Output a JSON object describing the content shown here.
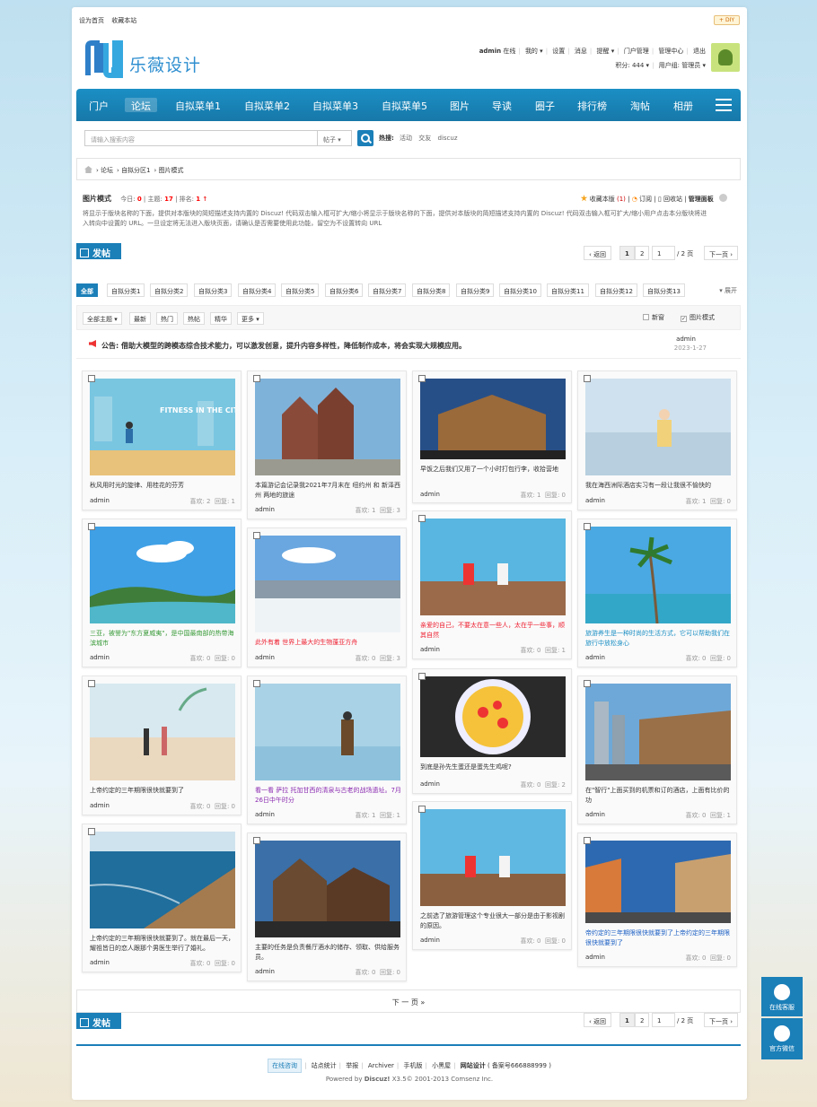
{
  "top": {
    "set_home": "设为首页",
    "bookmark": "收藏本站",
    "diy": "DIY"
  },
  "logo": {
    "text": "乐薇设计"
  },
  "user": {
    "name": "admin",
    "online": "在线",
    "mine": "我的",
    "settings": "设置",
    "messages": "消息",
    "remind": "提醒",
    "portal_manage": "门户管理",
    "admin_center": "管理中心",
    "logout": "退出",
    "points": "积分: 444",
    "group": "用户组: 管理员"
  },
  "nav": [
    "门户",
    "论坛",
    "自拟菜单1",
    "自拟菜单2",
    "自拟菜单3",
    "自拟菜单5",
    "图片",
    "导读",
    "圈子",
    "排行榜",
    "淘帖",
    "相册"
  ],
  "search": {
    "placeholder": "请输入搜索内容",
    "type": "帖子",
    "hot_label": "热搜:",
    "hot": [
      "活动",
      "交友",
      "discuz"
    ]
  },
  "breadcrumb": [
    "论坛",
    "自拟分区1",
    "图片模式"
  ],
  "forum": {
    "name": "图片模式",
    "today_label": "今日:",
    "today": "0",
    "threads_label": "主题:",
    "threads": "17",
    "rank_label": "排名:",
    "rank": "1",
    "fav": "收藏本版",
    "fav_count": "(1)",
    "subscribe": "订阅",
    "recycle": "回收站",
    "manage": "管理面板",
    "desc": "将显示于版块名称的下面，提供对本版块的简短描述支持内置的 Discuz! 代码双击输入框可扩大/缩小将显示于版块名称的下面，提供对本版块的简短描述支持内置的 Discuz! 代码双击输入框可扩大/缩小用户点击本分版块将进入转向中设置的 URL。一旦设定将无法进入版块页面，请确认是否需要使用此功能，留空为不设置转向 URL"
  },
  "post_btn": "发帖",
  "pager": {
    "back": "返回",
    "p1": "1",
    "p2": "2",
    "input": "1",
    "total": "/ 2 页",
    "next": "下一页"
  },
  "categories": [
    "全部",
    "自拟分类1",
    "自拟分类2",
    "自拟分类3",
    "自拟分类4",
    "自拟分类5",
    "自拟分类6",
    "自拟分类7",
    "自拟分类8",
    "自拟分类9",
    "自拟分类10",
    "自拟分类11",
    "自拟分类12",
    "自拟分类13"
  ],
  "expand": "展开",
  "filters": {
    "all": "全部主题",
    "latest": "最新",
    "hot": "热门",
    "hotpost": "热帖",
    "digest": "精华",
    "more": "更多",
    "newwin": "新窗",
    "picmode": "图片模式"
  },
  "notice": {
    "text": "公告: 借助大模型的跨模态综合技术能力，可以激发创意，提升内容多样性，降低制作成本，将会实现大规模应用。",
    "author": "admin",
    "date": "2023-1-27"
  },
  "cards": [
    {
      "title": "秋风用时光的旋律、用桂花的芬芳",
      "color": "#333",
      "author": "admin",
      "likes": "喜欢: 2",
      "replies": "回复: 1"
    },
    {
      "title": "本篇游记会记录我2021年7月末在 纽约州 和 新泽西州 两地的旅途",
      "color": "#333",
      "author": "admin",
      "likes": "喜欢: 1",
      "replies": "回复: 3"
    },
    {
      "title": "早饭之后我们又用了一个小时打包行李，收拾营地",
      "color": "#333",
      "author": "admin",
      "likes": "喜欢: 1",
      "replies": "回复: 0"
    },
    {
      "title": "我在海西洲际酒店实习有一段让我很不愉快的",
      "color": "#333",
      "author": "admin",
      "likes": "喜欢: 1",
      "replies": "回复: 0"
    },
    {
      "title": "三亚，被誉为\"东方夏威夷\"，是中国最南部的热带海滨城市",
      "color": "#3a9b3a",
      "author": "admin",
      "likes": "喜欢: 0",
      "replies": "回复: 0"
    },
    {
      "title": "此外有着 世界上最大的生物蓬亚方舟",
      "color": "#e23",
      "author": "admin",
      "likes": "喜欢: 0",
      "replies": "回复: 3"
    },
    {
      "title": "亲爱的自己，不要太在意一些人，太在乎一些事，顺其自然",
      "color": "#e23",
      "author": "admin",
      "likes": "喜欢: 0",
      "replies": "回复: 1"
    },
    {
      "title": "旅游养生是一种时尚的生活方式，它可以帮助我们在旅行中放松身心",
      "color": "#1b8fc4",
      "author": "admin",
      "likes": "喜欢: 0",
      "replies": "回复: 0"
    },
    {
      "title": "上帝约定的三年期限很快就要到了",
      "color": "#333",
      "author": "admin",
      "likes": "喜欢: 0",
      "replies": "回复: 0"
    },
    {
      "title": "看一看 萨拉 托加甘西的清泉与古老的战场遗址。7月26日中午时分",
      "color": "#8a2ab0",
      "author": "admin",
      "likes": "喜欢: 1",
      "replies": "回复: 1"
    },
    {
      "title": "到底是孙先生蛋还是蛋先生鸡呢?",
      "color": "#333",
      "author": "admin",
      "likes": "喜欢: 0",
      "replies": "回复: 2"
    },
    {
      "title": "在\"智行\"上面买到的机票和订的酒店，上面有比价的功",
      "color": "#333",
      "author": "admin",
      "likes": "喜欢: 0",
      "replies": "回复: 1"
    },
    {
      "title": "上帝约定的三年期限很快就要到了。就在最后一天，耀祖皆日的恋人跟那个男医生举行了婚礼。",
      "color": "#333",
      "author": "admin",
      "likes": "喜欢: 0",
      "replies": "回复: 0"
    },
    {
      "title": "主要的任务是负责餐厅酒水的储存、领取、供给服务员。",
      "color": "#333",
      "author": "admin",
      "likes": "喜欢: 0",
      "replies": "回复: 0"
    },
    {
      "title": "之前选了旅游管理这个专业很大一部分是由于影视剧的原因。",
      "color": "#333",
      "author": "admin",
      "likes": "喜欢: 0",
      "replies": "回复: 0"
    },
    {
      "title": "帝约定的三年期限很快就要到了上帝约定的三年期限很快就要到了",
      "color": "#1b5fc4",
      "author": "admin",
      "likes": "喜欢: 0",
      "replies": "回复: 0"
    }
  ],
  "bottom_next": "下 一 页 »",
  "footer": {
    "kf": "在线咨询",
    "stats": "站点统计",
    "report": "举报",
    "archiver": "Archiver",
    "mobile": "手机版",
    "blackroom": "小黑屋",
    "site": "网站设计",
    "icp": "( 备案号666888999 )",
    "powered": "Powered by",
    "discuz": "Discuz!",
    "copy": "X3.5© 2001-2013 Comsenz Inc."
  },
  "side": {
    "kf": "在线客服",
    "wechat": "官方微信"
  }
}
